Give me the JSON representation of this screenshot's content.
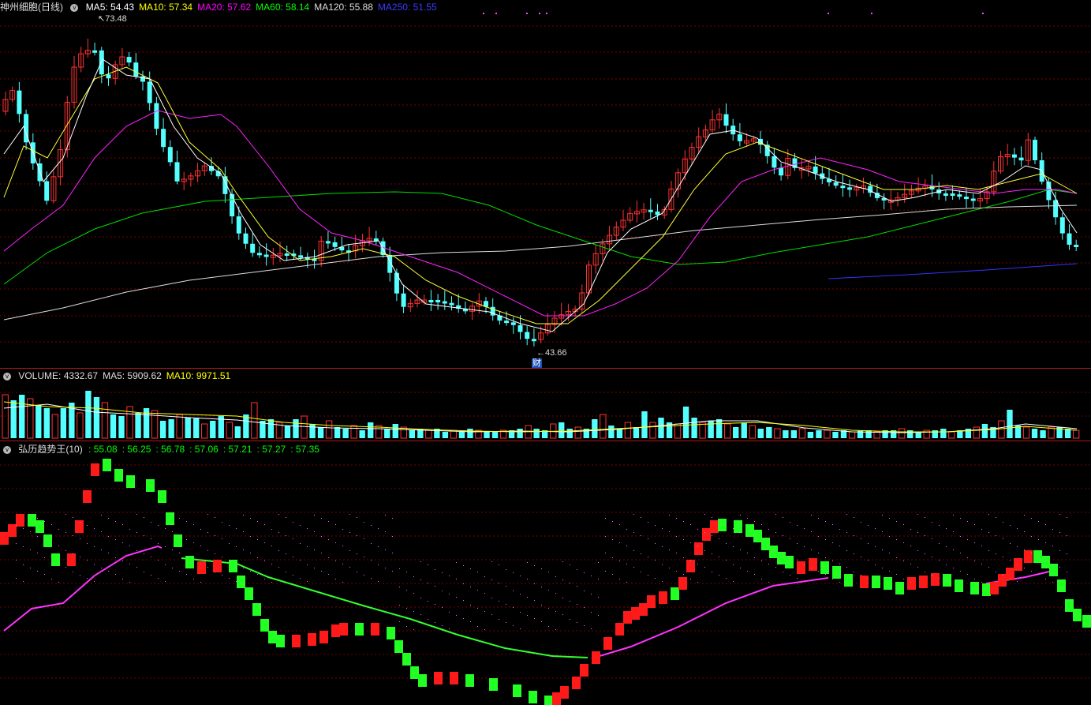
{
  "main": {
    "title": "神州细胞(日线)",
    "ma": [
      {
        "label": "MA5: 54.43",
        "color": "#ffffff"
      },
      {
        "label": "MA10: 57.34",
        "color": "#ffff00"
      },
      {
        "label": "MA20: 57.62",
        "color": "#ff00ff"
      },
      {
        "label": "MA60: 58.14",
        "color": "#00ff00"
      },
      {
        "label": "MA120: 55.88",
        "color": "#dddddd"
      },
      {
        "label": "MA250: 51.55",
        "color": "#3b3bff"
      }
    ],
    "high_label": "73.48",
    "low_label": "43.66",
    "finance_marker": "财"
  },
  "volume": {
    "labels": [
      {
        "label": "VOLUME: 4332.67",
        "color": "#dddddd"
      },
      {
        "label": "MA5: 5909.62",
        "color": "#dddddd"
      },
      {
        "label": "MA10: 9971.51",
        "color": "#ffff00"
      }
    ]
  },
  "indicator": {
    "title": "弘历趋势王(10)",
    "values": [
      {
        "label": ": 55.08",
        "color": "#00ff00"
      },
      {
        "label": ": 56.25",
        "color": "#00ff00"
      },
      {
        "label": ": 56.78",
        "color": "#00ff00"
      },
      {
        "label": ": 57.06",
        "color": "#00ff00"
      },
      {
        "label": ": 57.21",
        "color": "#00ff00"
      },
      {
        "label": ": 57.27",
        "color": "#00ff00"
      },
      {
        "label": ": 57.35",
        "color": "#00ff00"
      }
    ]
  },
  "colors": {
    "up": "#ff3232",
    "down": "#54ffff",
    "grid": "#7a0000",
    "red_step": "#ff1a1a",
    "green_step": "#22ff22"
  }
}
